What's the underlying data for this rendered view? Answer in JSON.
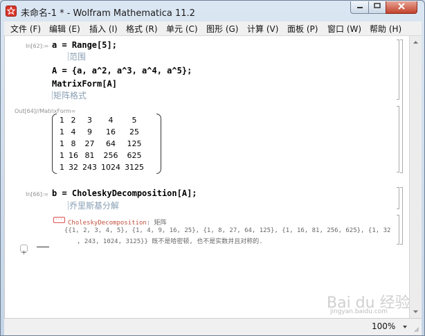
{
  "window": {
    "title": "未命名-1 * - Wolfram Mathematica 11.2"
  },
  "menu": [
    "文件 (F)",
    "编辑 (E)",
    "插入 (I)",
    "格式 (R)",
    "单元 (C)",
    "图形 (G)",
    "计算 (V)",
    "面板 (P)",
    "窗口 (W)",
    "帮助 (H)"
  ],
  "cells": {
    "in62_label": "In[62]:=",
    "in62_line1": "a = Range[5];",
    "in62_comment1": "范围",
    "in62_line2": "A = {a, a^2, a^3, a^4, a^5};",
    "in62_line3": "MatrixForm[A]",
    "in62_comment2": "矩阵格式",
    "out64_label": "Out[64]//MatrixForm=",
    "matrix": [
      [
        "1",
        "2",
        "3",
        "4",
        "5"
      ],
      [
        "1",
        "4",
        "9",
        "16",
        "25"
      ],
      [
        "1",
        "8",
        "27",
        "64",
        "125"
      ],
      [
        "1",
        "16",
        "81",
        "256",
        "625"
      ],
      [
        "1",
        "32",
        "243",
        "1024",
        "3125"
      ]
    ],
    "in66_label": "In[66]:=",
    "in66_line1": "b = CholeskyDecomposition[A];",
    "in66_comment1": "乔里斯基分解",
    "msg_name": "CholeskyDecomposition",
    "msg_sep": ": 矩阵",
    "msg_line1": "{{1, 2, 3, 4, 5}, {1, 4, 9, 16, 25}, {1, 8, 27, 64, 125}, {1, 16, 81, 256, 625}, {1, 32",
    "msg_line2": ", 243, 1024, 3125}} 既不是哈密顿, 也不是实数并且对称的."
  },
  "status": {
    "zoom": "100%"
  },
  "watermark": {
    "text": "Bai du 经验",
    "sub": "jingyan.baidu.com"
  },
  "colors": {
    "code": "#000000",
    "comment": "#8aa0b5",
    "message_name": "#c4513f",
    "cell_label": "#8f8f8f"
  }
}
